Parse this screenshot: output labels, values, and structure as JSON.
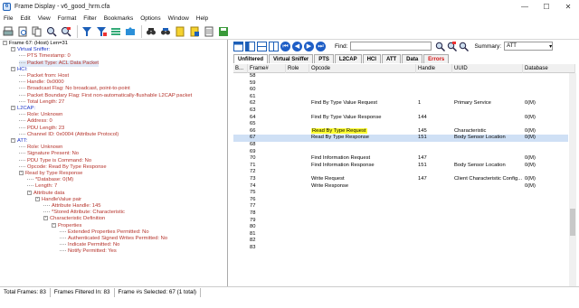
{
  "window": {
    "title": "Frame Display - v6_good_hrm.cfa",
    "app_glyph": "6"
  },
  "window_controls": {
    "minimize": "—",
    "maximize": "☐",
    "close": "✕"
  },
  "menu": [
    "File",
    "Edit",
    "View",
    "Format",
    "Filter",
    "Bookmarks",
    "Options",
    "Window",
    "Help"
  ],
  "toolbar_icons": [
    "print-icon",
    "print-preview-icon",
    "copy-icon",
    "find-icon",
    "find-next-icon",
    "filter-icon",
    "quick-filter-icon",
    "stack-icon",
    "export-icon",
    "binoculars-icon",
    "binoculars-next-icon",
    "bookmark-icon",
    "bookmark-next-icon",
    "notes-icon",
    "save-icon"
  ],
  "tree": [
    {
      "text": "Frame 67: (Host) Len=31",
      "color": "black",
      "indent": 0,
      "toggle": "-"
    },
    {
      "text": "Virtual Sniffer:",
      "color": "blue",
      "indent": 1,
      "toggle": "-"
    },
    {
      "text": "PTS Timestamp: 0",
      "color": "red",
      "indent": 2,
      "toggle": ""
    },
    {
      "text": "Packet Type: ACL Data Packet",
      "color": "red",
      "indent": 2,
      "toggle": "",
      "selected": true
    },
    {
      "text": "HCI:",
      "color": "blue",
      "indent": 1,
      "toggle": "-"
    },
    {
      "text": "Packet from: Host",
      "color": "red",
      "indent": 2,
      "toggle": ""
    },
    {
      "text": "Handle: 0x0000",
      "color": "red",
      "indent": 2,
      "toggle": ""
    },
    {
      "text": "Broadcast Flag: No broadcast, point-to-point",
      "color": "red",
      "indent": 2,
      "toggle": ""
    },
    {
      "text": "Packet Boundary Flag: First non-automatically-flushable L2CAP packet",
      "color": "red",
      "indent": 2,
      "toggle": ""
    },
    {
      "text": "Total Length: 27",
      "color": "red",
      "indent": 2,
      "toggle": ""
    },
    {
      "text": "L2CAP:",
      "color": "blue",
      "indent": 1,
      "toggle": "-"
    },
    {
      "text": "Role: Unknown",
      "color": "red",
      "indent": 2,
      "toggle": ""
    },
    {
      "text": "Address: 0",
      "color": "red",
      "indent": 2,
      "toggle": ""
    },
    {
      "text": "PDU Length: 23",
      "color": "red",
      "indent": 2,
      "toggle": ""
    },
    {
      "text": "Channel ID: 0x0004 (Attribute Protocol)",
      "color": "red",
      "indent": 2,
      "toggle": ""
    },
    {
      "text": "ATT:",
      "color": "blue",
      "indent": 1,
      "toggle": "-"
    },
    {
      "text": "Role: Unknown",
      "color": "red",
      "indent": 2,
      "toggle": ""
    },
    {
      "text": "Signature Present: No",
      "color": "red",
      "indent": 2,
      "toggle": ""
    },
    {
      "text": "PDU Type is Command: No",
      "color": "red",
      "indent": 2,
      "toggle": ""
    },
    {
      "text": "Opcode: Read By Type Response",
      "color": "red",
      "indent": 2,
      "toggle": ""
    },
    {
      "text": "Read by Type Response",
      "color": "red",
      "indent": 2,
      "toggle": "-"
    },
    {
      "text": "*Database: 0(M)",
      "color": "red",
      "indent": 3,
      "toggle": ""
    },
    {
      "text": "Length: 7",
      "color": "red",
      "indent": 3,
      "toggle": ""
    },
    {
      "text": "Attribute data",
      "color": "red",
      "indent": 3,
      "toggle": "-"
    },
    {
      "text": "HandleValue pair",
      "color": "red",
      "indent": 4,
      "toggle": "-"
    },
    {
      "text": "Attribute Handle: 145",
      "color": "red",
      "indent": 5,
      "toggle": ""
    },
    {
      "text": "*Stored Attribute: Characteristic",
      "color": "red",
      "indent": 5,
      "toggle": ""
    },
    {
      "text": "Characteristic Definition",
      "color": "red",
      "indent": 5,
      "toggle": "-"
    },
    {
      "text": "Properties",
      "color": "red",
      "indent": 6,
      "toggle": "-"
    },
    {
      "text": "Extended Properties Permitted: No",
      "color": "red",
      "indent": 7,
      "toggle": ""
    },
    {
      "text": "Authenticated Signed Writes Permitted: No",
      "color": "red",
      "indent": 7,
      "toggle": ""
    },
    {
      "text": "Indicate Permitted: No",
      "color": "red",
      "indent": 7,
      "toggle": ""
    },
    {
      "text": "Notify Permitted: Yes",
      "color": "red",
      "indent": 7,
      "toggle": ""
    }
  ],
  "right_toolbar": {
    "icons": [
      "layout-1-icon",
      "layout-2-icon",
      "layout-3-icon",
      "layout-4-icon",
      "nav-first-icon",
      "nav-prev-icon",
      "nav-next-icon",
      "nav-last-icon"
    ],
    "nav_glyphs": [
      "⏮",
      "◀",
      "▶",
      "⏭"
    ],
    "find_label": "Find:",
    "find_value": "",
    "summary_label": "Summary:",
    "summary_value": "ATT",
    "summary_arrow": "▾"
  },
  "tabs": [
    {
      "label": "Unfiltered",
      "active": true
    },
    {
      "label": "Virtual Sniffer"
    },
    {
      "label": "PTS"
    },
    {
      "label": "L2CAP"
    },
    {
      "label": "HCI"
    },
    {
      "label": "ATT"
    },
    {
      "label": "Data"
    },
    {
      "label": "Errors",
      "errors": true
    }
  ],
  "columns": [
    "B...",
    "Frame#",
    "Role",
    "Opcode",
    "Handle",
    "UUID",
    "Database"
  ],
  "rows": [
    {
      "frame": "58",
      "role": "",
      "opcode": "",
      "handle": "",
      "uuid": "",
      "db": ""
    },
    {
      "frame": "59",
      "role": "",
      "opcode": "",
      "handle": "",
      "uuid": "",
      "db": ""
    },
    {
      "frame": "60",
      "role": "",
      "opcode": "",
      "handle": "",
      "uuid": "",
      "db": ""
    },
    {
      "frame": "61",
      "role": "",
      "opcode": "",
      "handle": "",
      "uuid": "",
      "db": ""
    },
    {
      "frame": "62",
      "role": "",
      "opcode": "Find By Type Value Request",
      "handle": "1",
      "uuid": "Primary Service",
      "db": "0(M)"
    },
    {
      "frame": "63",
      "role": "",
      "opcode": "",
      "handle": "",
      "uuid": "",
      "db": ""
    },
    {
      "frame": "64",
      "role": "",
      "opcode": "Find By Type Value Response",
      "handle": "144",
      "uuid": "",
      "db": "0(M)"
    },
    {
      "frame": "65",
      "role": "",
      "opcode": "",
      "handle": "",
      "uuid": "",
      "db": ""
    },
    {
      "frame": "66",
      "role": "",
      "opcode": "Read By Type Request",
      "handle": "145",
      "uuid": "Characteristic",
      "db": "0(M)",
      "highlight": true
    },
    {
      "frame": "67",
      "role": "",
      "opcode": "Read By Type Response",
      "handle": "151",
      "uuid": "Body Sensor Location",
      "db": "0(M)",
      "selected": true
    },
    {
      "frame": "68",
      "role": "",
      "opcode": "",
      "handle": "",
      "uuid": "",
      "db": ""
    },
    {
      "frame": "69",
      "role": "",
      "opcode": "",
      "handle": "",
      "uuid": "",
      "db": ""
    },
    {
      "frame": "70",
      "role": "",
      "opcode": "Find Information Request",
      "handle": "147",
      "uuid": "",
      "db": "0(M)"
    },
    {
      "frame": "71",
      "role": "",
      "opcode": "Find Information Response",
      "handle": "151",
      "uuid": "Body Sensor Location",
      "db": "0(M)"
    },
    {
      "frame": "72",
      "role": "",
      "opcode": "",
      "handle": "",
      "uuid": "",
      "db": ""
    },
    {
      "frame": "73",
      "role": "",
      "opcode": "Write Request",
      "handle": "147",
      "uuid": "Client Characteristic Config...",
      "db": "0(M)"
    },
    {
      "frame": "74",
      "role": "",
      "opcode": "Write Response",
      "handle": "",
      "uuid": "",
      "db": "0(M)"
    },
    {
      "frame": "75",
      "role": "",
      "opcode": "",
      "handle": "",
      "uuid": "",
      "db": ""
    },
    {
      "frame": "76",
      "role": "",
      "opcode": "",
      "handle": "",
      "uuid": "",
      "db": ""
    },
    {
      "frame": "77",
      "role": "",
      "opcode": "",
      "handle": "",
      "uuid": "",
      "db": ""
    },
    {
      "frame": "78",
      "role": "",
      "opcode": "",
      "handle": "",
      "uuid": "",
      "db": ""
    },
    {
      "frame": "79",
      "role": "",
      "opcode": "",
      "handle": "",
      "uuid": "",
      "db": ""
    },
    {
      "frame": "80",
      "role": "",
      "opcode": "",
      "handle": "",
      "uuid": "",
      "db": ""
    },
    {
      "frame": "81",
      "role": "",
      "opcode": "",
      "handle": "",
      "uuid": "",
      "db": ""
    },
    {
      "frame": "82",
      "role": "",
      "opcode": "",
      "handle": "",
      "uuid": "",
      "db": ""
    },
    {
      "frame": "83",
      "role": "",
      "opcode": "",
      "handle": "",
      "uuid": "",
      "db": ""
    }
  ],
  "status": {
    "total_frames": "Total Frames: 83",
    "frames_filtered": "Frames Filtered In: 83",
    "selected": "Frame #s Selected: 67 (1 total)"
  },
  "colors": {
    "tree_blue": "#1a33c8",
    "tree_red": "#b5322a",
    "selection": "#cfe0f5",
    "highlight": "#ffff33",
    "error_tab": "#d01010"
  }
}
